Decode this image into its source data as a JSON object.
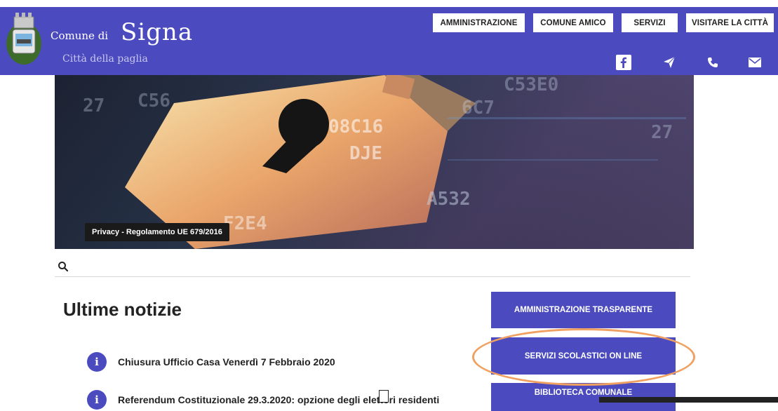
{
  "header": {
    "brand_prefix": "Comune di",
    "brand_name": "Signa",
    "tagline": "Città della paglia",
    "bg_color": "#4b4bbf",
    "nav": [
      {
        "label": "AMMINISTRAZIONE"
      },
      {
        "label": "COMUNE AMICO"
      },
      {
        "label": "SERVIZI"
      },
      {
        "label": "VISITARE LA CITTÀ"
      }
    ],
    "social_icons": [
      "facebook-icon",
      "telegram-icon",
      "phone-icon",
      "email-icon"
    ]
  },
  "hero": {
    "caption": "Privacy - Regolamento UE 679/2016",
    "image_text": [
      "C56",
      "27",
      "08C16",
      "DJE",
      "F2E4",
      "6C7",
      "A532",
      "C53E0",
      "27"
    ]
  },
  "search": {
    "icon": "search-icon"
  },
  "news": {
    "title": "Ultime notizie",
    "items": [
      {
        "text": "Chiusura Ufficio Casa Venerdì 7 Febbraio 2020"
      },
      {
        "text": "Referendum Costituzionale 29.3.2020: opzione degli elettori residenti"
      }
    ]
  },
  "sidebar_buttons": [
    {
      "label": "AMMINISTRAZIONE TRASPARENTE"
    },
    {
      "label": "SERVIZI SCOLASTICI ON LINE"
    },
    {
      "label": "BIBLIOTECA COMUNALE"
    }
  ],
  "colors": {
    "accent": "#4b4bbf",
    "highlight": "#f0a060"
  }
}
